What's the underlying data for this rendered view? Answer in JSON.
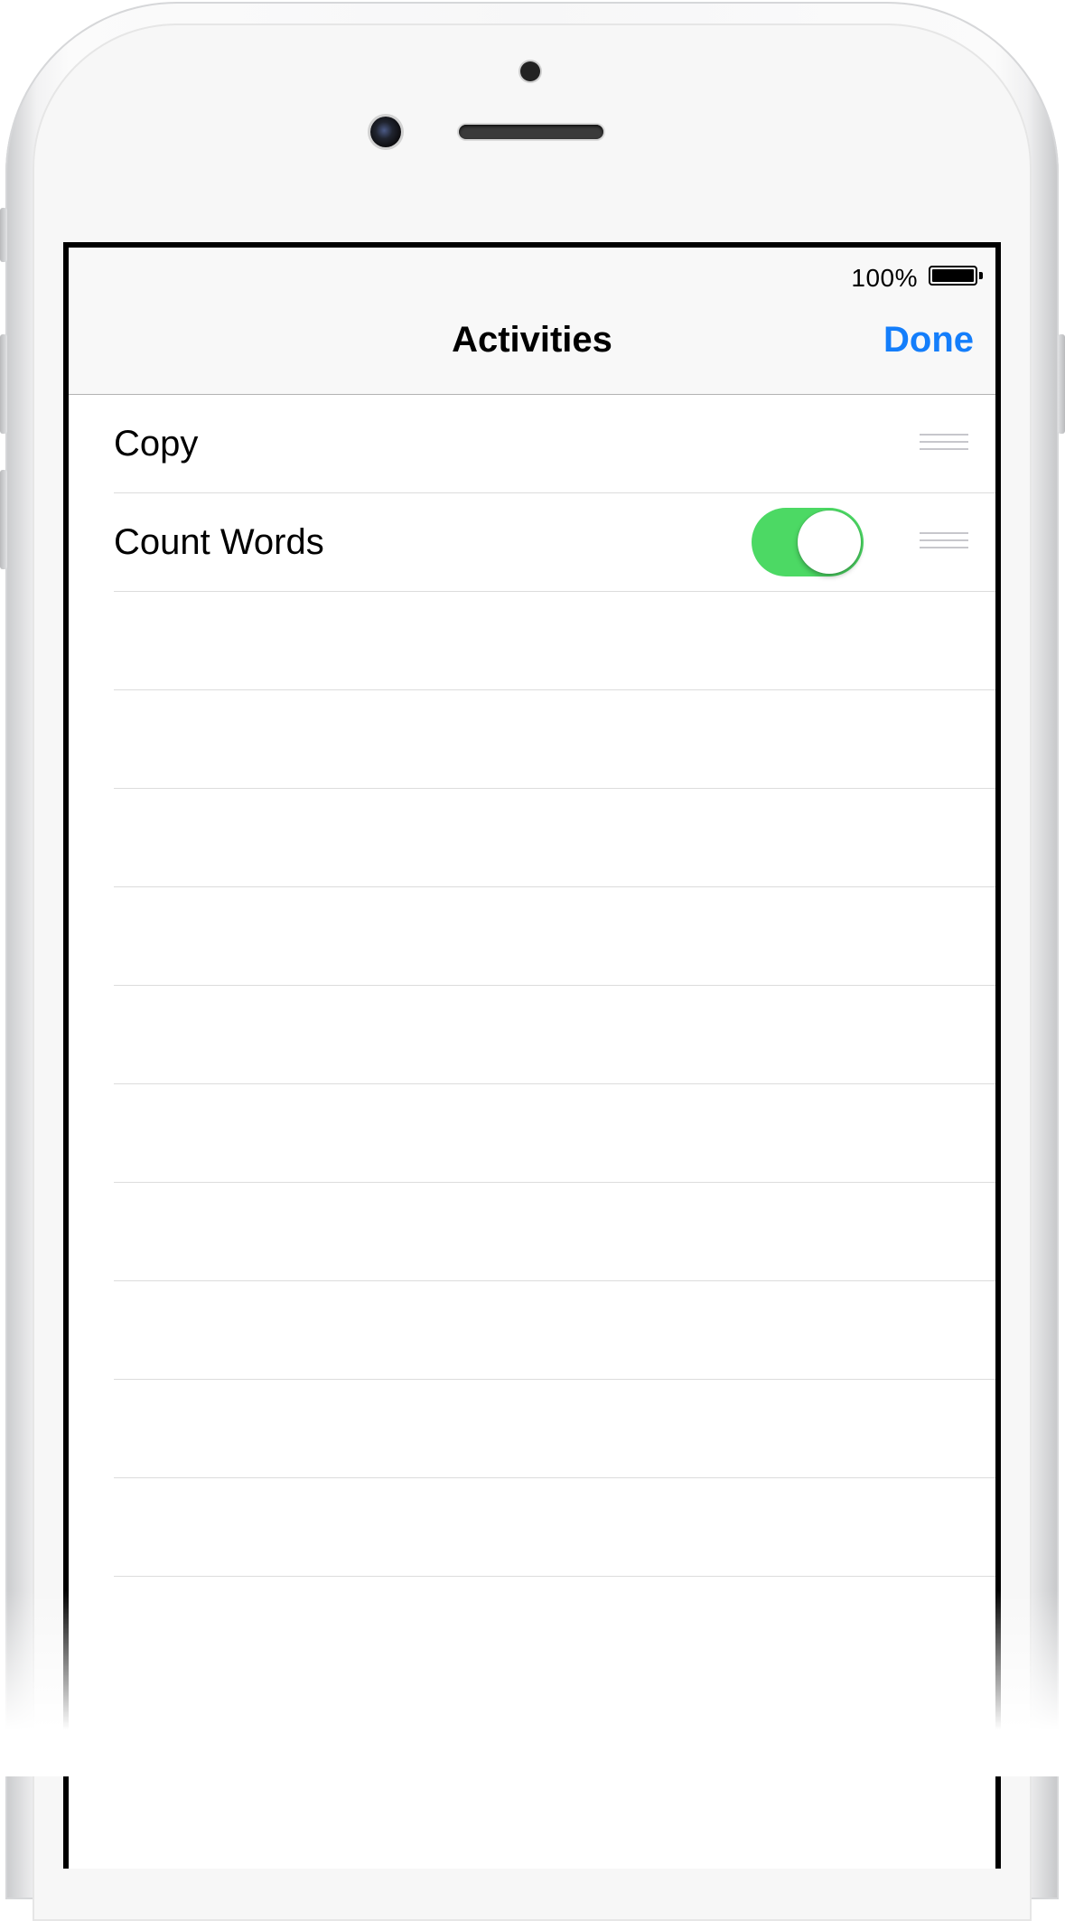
{
  "status_bar": {
    "battery_percent": "100%",
    "battery_level": 1.0
  },
  "nav": {
    "title": "Activities",
    "done_label": "Done"
  },
  "activities": [
    {
      "label": "Copy",
      "has_toggle": false
    },
    {
      "label": "Count Words",
      "has_toggle": true,
      "toggle_on": true
    }
  ],
  "empty_row_count": 10,
  "colors": {
    "accent": "#147efb",
    "toggle_on": "#4cd964",
    "separator": "#dcdcdc"
  },
  "icons": {
    "reorder": "reorder-handle-icon",
    "battery": "battery-icon"
  }
}
